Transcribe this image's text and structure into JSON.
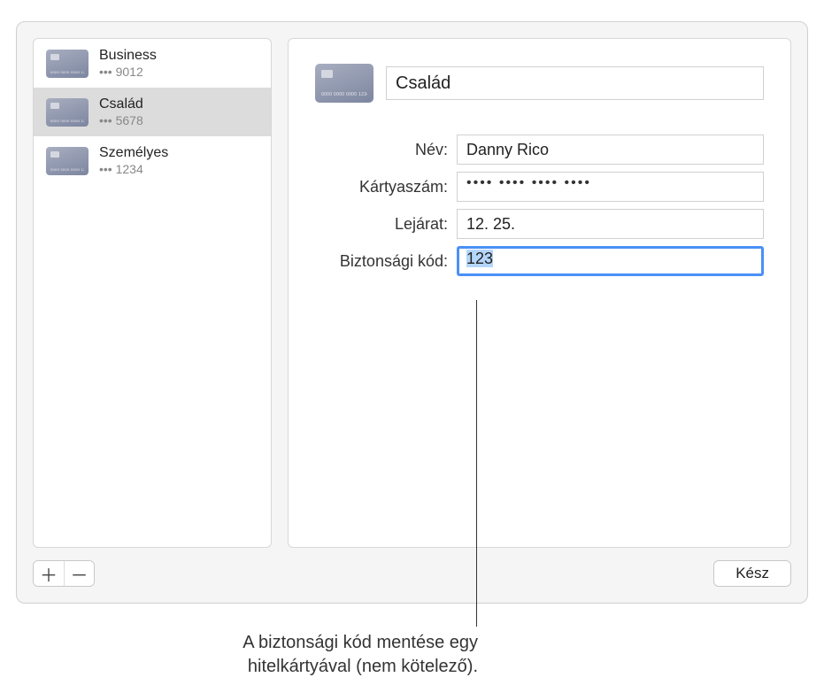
{
  "sidebar": {
    "cards": [
      {
        "title": "Business",
        "sub": "••• 9012",
        "selected": false
      },
      {
        "title": "Család",
        "sub": "••• 5678",
        "selected": true
      },
      {
        "title": "Személyes",
        "sub": "••• 1234",
        "selected": false
      }
    ]
  },
  "detail": {
    "title_value": "Család",
    "fields": {
      "name": {
        "label": "Név:",
        "value": "Danny Rico"
      },
      "number": {
        "label": "Kártyaszám:",
        "value": "•••• •••• •••• ••••"
      },
      "expiry": {
        "label": "Lejárat:",
        "value": "12. 25."
      },
      "security": {
        "label": "Biztonsági kód:",
        "value": "123"
      }
    }
  },
  "buttons": {
    "done": "Kész",
    "add_glyph": "＋",
    "remove_glyph": "－"
  },
  "callout": {
    "line1": "A biztonsági kód mentése egy",
    "line2": "hitelkártyával (nem kötelező)."
  }
}
